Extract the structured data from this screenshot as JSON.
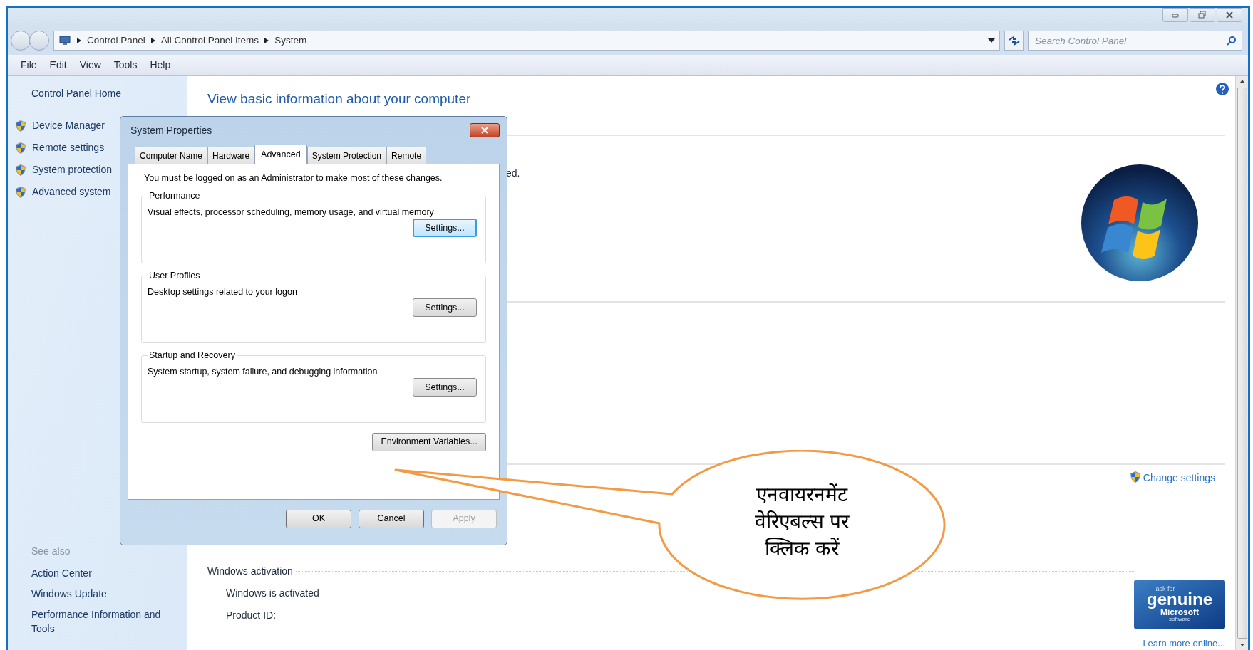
{
  "window": {
    "controls": [
      {
        "kind": "minimize"
      },
      {
        "kind": "maximize"
      },
      {
        "kind": "close"
      }
    ]
  },
  "address_bar": {
    "breadcrumbs": [
      "Control Panel",
      "All Control Panel Items",
      "System"
    ]
  },
  "search": {
    "placeholder": "Search Control Panel"
  },
  "menu": [
    "File",
    "Edit",
    "View",
    "Tools",
    "Help"
  ],
  "sidebar": {
    "home": "Control Panel Home",
    "items": [
      {
        "label": "Device Manager"
      },
      {
        "label": "Remote settings"
      },
      {
        "label": "System protection"
      },
      {
        "label": "Advanced system"
      }
    ],
    "see_also_title": "See also",
    "see_also": [
      "Action Center",
      "Windows Update",
      "Performance Information and Tools"
    ]
  },
  "main": {
    "heading": "View basic information about your computer",
    "fragment": "ed.",
    "change_settings": "Change settings",
    "activation": {
      "title": "Windows activation",
      "status": "Windows is activated",
      "product_id_label": "Product ID:"
    },
    "genuine_badge": {
      "line_1": "ask for",
      "line_2": "genuine",
      "line_3": "Microsoft",
      "line_4": "software"
    },
    "learn_more": "Learn more online..."
  },
  "dialog": {
    "title": "System Properties",
    "tabs": [
      {
        "label": "Computer Name",
        "selected": false
      },
      {
        "label": "Hardware",
        "selected": false
      },
      {
        "label": "Advanced",
        "selected": true
      },
      {
        "label": "System Protection",
        "selected": false
      },
      {
        "label": "Remote",
        "selected": false
      }
    ],
    "notice": "You must be logged on as an Administrator to make most of these changes.",
    "groups": [
      {
        "title": "Performance",
        "description": "Visual effects, processor scheduling, memory usage, and virtual memory",
        "button": "Settings...",
        "focused": true
      },
      {
        "title": "User Profiles",
        "description": "Desktop settings related to your logon",
        "button": "Settings...",
        "focused": false
      },
      {
        "title": "Startup and Recovery",
        "description": "System startup, system failure, and debugging information",
        "button": "Settings...",
        "focused": false
      }
    ],
    "env_button": "Environment Variables...",
    "buttons": [
      {
        "label": "OK",
        "disabled": false
      },
      {
        "label": "Cancel",
        "disabled": false
      },
      {
        "label": "Apply",
        "disabled": true
      }
    ]
  },
  "callout": {
    "lines": [
      "एनवायरनमेंट",
      "वेरिएबल्स पर",
      "क्लिक करें"
    ]
  }
}
